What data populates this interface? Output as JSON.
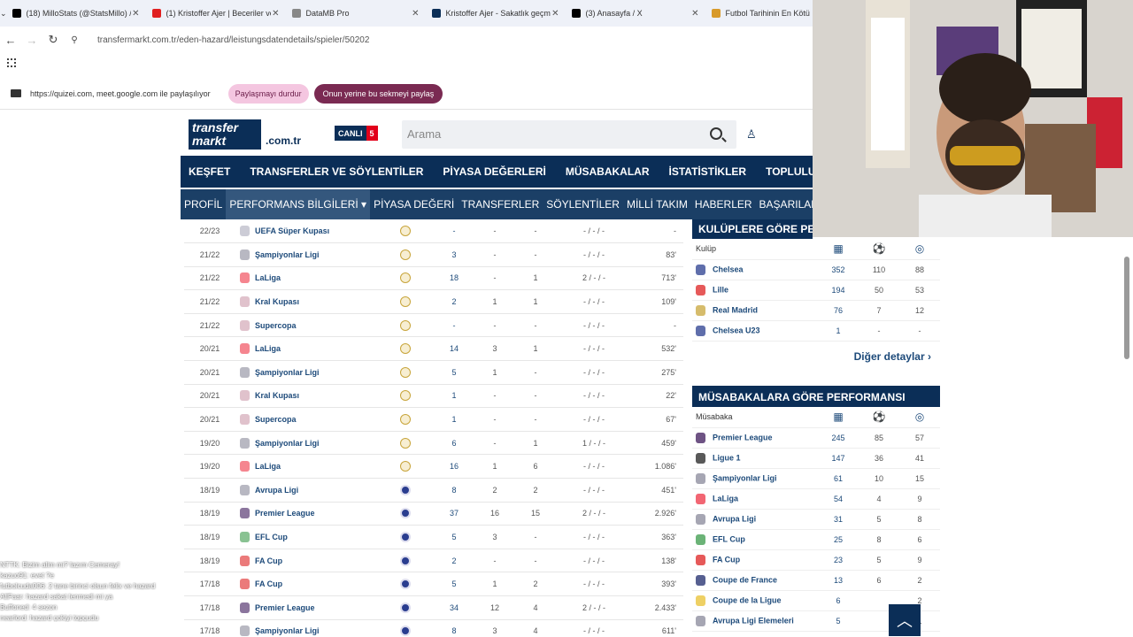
{
  "browser": {
    "tabs": [
      {
        "title": "(18) MilloStats (@StatsMillo) / X",
        "color": "#000000"
      },
      {
        "title": "(1) Kristoffer Ajer | Beceriler ve İ",
        "color": "#e02020"
      },
      {
        "title": "DataMB Pro",
        "color": "#888888"
      },
      {
        "title": "Kristoffer Ajer - Sakatlık geçmişi",
        "color": "#0b2e57"
      },
      {
        "title": "(3) Anasayfa / X",
        "color": "#000000"
      },
      {
        "title": "Futbol Tarihinin En Kötü",
        "color": "#d89a2a"
      }
    ],
    "url": "transfermarkt.com.tr/eden-hazard/leistungsdatendetails/spieler/50202",
    "share_text": "https://quizei.com, meet.google.com ile paylaşılıyor",
    "stop_share": "Paylaşmayı durdur",
    "share_this_tab": "Onun yerine bu sekmeyi paylaş"
  },
  "site": {
    "logo": "transfer markt",
    "domain": ".com.tr",
    "live_label": "CANLI",
    "live_count": "5",
    "search_placeholder": "Arama",
    "main_nav": [
      "KEŞFET",
      "TRANSFERLER VE SÖYLENTİLER",
      "PİYASA DEĞERLERİ",
      "MÜSABAKALAR",
      "İSTATİSTİKLER",
      "TOPLULUK"
    ],
    "sub_nav": [
      "PROFİL",
      "PERFORMANS BİLGİLERİ ▾",
      "PİYASA DEĞERİ",
      "TRANSFERLER",
      "SÖYLENTİLER",
      "MİLLİ TAKIM",
      "HABERLER",
      "BAŞARILAR",
      "KARİYER ▾"
    ]
  },
  "perf_rows": [
    {
      "season": "22/23",
      "comp": "UEFA Süper Kupası",
      "club": "rm",
      "apps": "-",
      "goals": "-",
      "assists": "-",
      "cards": "- / - / -",
      "mins": "-",
      "icon": "#aab"
    },
    {
      "season": "21/22",
      "comp": "Şampiyonlar Ligi",
      "club": "rm",
      "apps": "3",
      "goals": "-",
      "assists": "-",
      "cards": "- / - / -",
      "mins": "83'",
      "icon": "#889"
    },
    {
      "season": "21/22",
      "comp": "LaLiga",
      "club": "rm",
      "apps": "18",
      "goals": "-",
      "assists": "1",
      "cards": "2 / - / -",
      "mins": "713'",
      "icon": "#e34"
    },
    {
      "season": "21/22",
      "comp": "Kral Kupası",
      "club": "rm",
      "apps": "2",
      "goals": "1",
      "assists": "1",
      "cards": "- / - / -",
      "mins": "109'",
      "icon": "#c9a"
    },
    {
      "season": "21/22",
      "comp": "Supercopa",
      "club": "rm",
      "apps": "-",
      "goals": "-",
      "assists": "-",
      "cards": "- / - / -",
      "mins": "-",
      "icon": "#c9a"
    },
    {
      "season": "20/21",
      "comp": "LaLiga",
      "club": "rm",
      "apps": "14",
      "goals": "3",
      "assists": "1",
      "cards": "- / - / -",
      "mins": "532'",
      "icon": "#e34"
    },
    {
      "season": "20/21",
      "comp": "Şampiyonlar Ligi",
      "club": "rm",
      "apps": "5",
      "goals": "1",
      "assists": "-",
      "cards": "- / - / -",
      "mins": "275'",
      "icon": "#889"
    },
    {
      "season": "20/21",
      "comp": "Kral Kupası",
      "club": "rm",
      "apps": "1",
      "goals": "-",
      "assists": "-",
      "cards": "- / - / -",
      "mins": "22'",
      "icon": "#c9a"
    },
    {
      "season": "20/21",
      "comp": "Supercopa",
      "club": "rm",
      "apps": "1",
      "goals": "-",
      "assists": "-",
      "cards": "- / - / -",
      "mins": "67'",
      "icon": "#c9a"
    },
    {
      "season": "19/20",
      "comp": "Şampiyonlar Ligi",
      "club": "rm",
      "apps": "6",
      "goals": "-",
      "assists": "1",
      "cards": "1 / - / -",
      "mins": "459'",
      "icon": "#889"
    },
    {
      "season": "19/20",
      "comp": "LaLiga",
      "club": "rm",
      "apps": "16",
      "goals": "1",
      "assists": "6",
      "cards": "- / - / -",
      "mins": "1.086'",
      "icon": "#e34"
    },
    {
      "season": "18/19",
      "comp": "Avrupa Ligi",
      "club": "ch",
      "apps": "8",
      "goals": "2",
      "assists": "2",
      "cards": "- / - / -",
      "mins": "451'",
      "icon": "#889"
    },
    {
      "season": "18/19",
      "comp": "Premier League",
      "club": "ch",
      "apps": "37",
      "goals": "16",
      "assists": "15",
      "cards": "2 / - / -",
      "mins": "2.926'",
      "icon": "#3d195b"
    },
    {
      "season": "18/19",
      "comp": "EFL Cup",
      "club": "ch",
      "apps": "5",
      "goals": "3",
      "assists": "-",
      "cards": "- / - / -",
      "mins": "363'",
      "icon": "#3a9a4a"
    },
    {
      "season": "18/19",
      "comp": "FA Cup",
      "club": "ch",
      "apps": "2",
      "goals": "-",
      "assists": "-",
      "cards": "- / - / -",
      "mins": "138'",
      "icon": "#d22"
    },
    {
      "season": "17/18",
      "comp": "FA Cup",
      "club": "ch",
      "apps": "5",
      "goals": "1",
      "assists": "2",
      "cards": "- / - / -",
      "mins": "393'",
      "icon": "#d22"
    },
    {
      "season": "17/18",
      "comp": "Premier League",
      "club": "ch",
      "apps": "34",
      "goals": "12",
      "assists": "4",
      "cards": "2 / - / -",
      "mins": "2.433'",
      "icon": "#3d195b"
    },
    {
      "season": "17/18",
      "comp": "Şampiyonlar Ligi",
      "club": "ch",
      "apps": "8",
      "goals": "3",
      "assists": "4",
      "cards": "- / - / -",
      "mins": "611'",
      "icon": "#889"
    }
  ],
  "by_club": {
    "title": "KULÜPLERE GÖRE PERFORMANS",
    "col_label": "Kulüp",
    "rows": [
      {
        "name": "Chelsea",
        "apps": "352",
        "goals": "110",
        "assists": "88",
        "color": "#2a3d8f"
      },
      {
        "name": "Lille",
        "apps": "194",
        "goals": "50",
        "assists": "53",
        "color": "#d22"
      },
      {
        "name": "Real Madrid",
        "apps": "76",
        "goals": "7",
        "assists": "12",
        "color": "#c8a53b"
      },
      {
        "name": "Chelsea U23",
        "apps": "1",
        "goals": "-",
        "assists": "-",
        "color": "#2a3d8f"
      }
    ],
    "more": "Diğer detaylar"
  },
  "by_comp": {
    "title": "MÜSABAKALARA GÖRE PERFORMANSI",
    "col_label": "Müsabaka",
    "rows": [
      {
        "name": "Premier League",
        "apps": "245",
        "goals": "85",
        "assists": "57",
        "color": "#3d195b"
      },
      {
        "name": "Ligue 1",
        "apps": "147",
        "goals": "36",
        "assists": "41",
        "color": "#222"
      },
      {
        "name": "Şampiyonlar Ligi",
        "apps": "61",
        "goals": "10",
        "assists": "15",
        "color": "#889"
      },
      {
        "name": "LaLiga",
        "apps": "54",
        "goals": "4",
        "assists": "9",
        "color": "#e34"
      },
      {
        "name": "Avrupa Ligi",
        "apps": "31",
        "goals": "5",
        "assists": "8",
        "color": "#889"
      },
      {
        "name": "EFL Cup",
        "apps": "25",
        "goals": "8",
        "assists": "6",
        "color": "#3a9a4a"
      },
      {
        "name": "FA Cup",
        "apps": "23",
        "goals": "5",
        "assists": "9",
        "color": "#d22"
      },
      {
        "name": "Coupe de France",
        "apps": "13",
        "goals": "6",
        "assists": "2",
        "color": "#1d2a6b"
      },
      {
        "name": "Coupe de la Ligue",
        "apps": "6",
        "goals": "",
        "assists": "2",
        "color": "#e8c030"
      },
      {
        "name": "Avrupa Ligi Elemeleri",
        "apps": "5",
        "goals": "",
        "assists": "1",
        "color": "#889"
      }
    ]
  },
  "chat": [
    "NTTK: Bizim alim mi? lazım Cemeray!",
    "kazuo91: evet ?e",
    "futbolcuda006: 2 tane birinci olsun felix ve hazard",
    "AllFaar: hazard sakat lenmedi mi ya",
    "Buffoned: 4 sezon",
    "nearlord: hazard çokiyi topçudu"
  ]
}
